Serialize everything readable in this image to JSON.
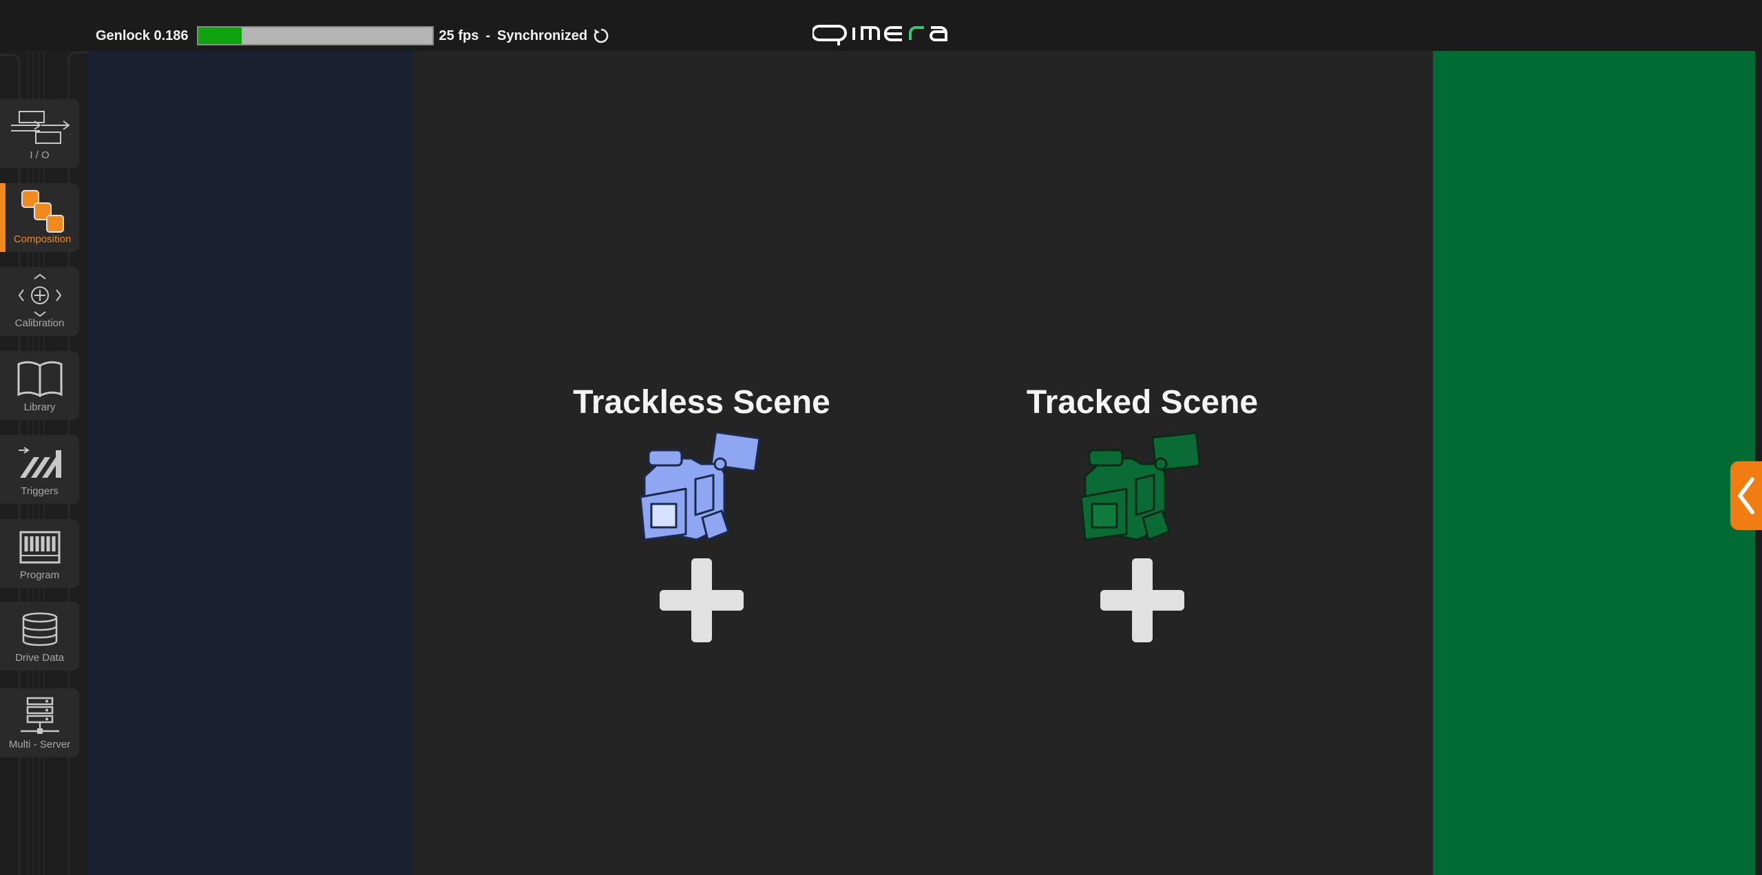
{
  "header": {
    "genlock_label": "Genlock 0.186",
    "genlock_progress": 0.186,
    "fps_text": "25 fps",
    "separator": "-",
    "sync_status": "Synchronized",
    "logo_text": "qimera",
    "logo_accent_color": "#2ecc71"
  },
  "sidebar": {
    "items": [
      {
        "label": "I / O",
        "icon": "io-arrows-icon",
        "active": false
      },
      {
        "label": "Composition",
        "icon": "composition-layers-icon",
        "active": true
      },
      {
        "label": "Calibration",
        "icon": "calibration-crosshair-icon",
        "active": false
      },
      {
        "label": "Library",
        "icon": "library-book-icon",
        "active": false
      },
      {
        "label": "Triggers",
        "icon": "triggers-icon",
        "active": false
      },
      {
        "label": "Program",
        "icon": "program-piano-icon",
        "active": false
      },
      {
        "label": "Drive Data",
        "icon": "drive-data-database-icon",
        "active": false
      },
      {
        "label": "Multi - Server",
        "icon": "multi-server-icon",
        "active": false
      }
    ]
  },
  "main": {
    "trackless": {
      "title": "Trackless Scene",
      "camera_color": "#8fa6f2",
      "icon": "camera-icon"
    },
    "tracked": {
      "title": "Tracked Scene",
      "camera_color": "#0a6b35",
      "icon": "camera-icon"
    }
  },
  "colors": {
    "accent": "#f08a1e",
    "left_panel": "#1a2030",
    "center_panel": "#242424",
    "right_panel": "#026b33",
    "genlock_fill": "#0fa30f"
  }
}
